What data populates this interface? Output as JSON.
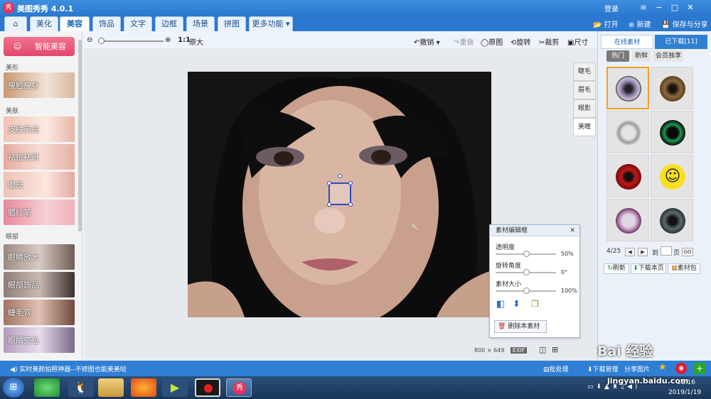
{
  "app": {
    "title": "美图秀秀 4.0.1",
    "logo_text": "秀",
    "login": "登录",
    "min": "−",
    "max": "□",
    "close": "✕"
  },
  "tabs": [
    {
      "label": "⌂"
    },
    {
      "label": "美化"
    },
    {
      "label": "美容"
    },
    {
      "label": "饰品"
    },
    {
      "label": "文字"
    },
    {
      "label": "边框"
    },
    {
      "label": "场景"
    },
    {
      "label": "拼图"
    },
    {
      "label": "更多功能 ▾"
    }
  ],
  "rightmenu": {
    "open": "打开",
    "new": "新建",
    "save": "保存与分享"
  },
  "sidebar": {
    "smart": "智能美容",
    "sections": {
      "shape": "美形",
      "skin": "美肤",
      "eye": "眼部"
    },
    "items": [
      {
        "label": "瘦脸瘦身"
      },
      {
        "label": "皮肤美白"
      },
      {
        "label": "祛痘祛斑"
      },
      {
        "label": "磨皮"
      },
      {
        "label": "腮红笔"
      },
      {
        "label": "眼睛放大"
      },
      {
        "label": "眼部饰品"
      },
      {
        "label": "睫毛膏"
      },
      {
        "label": "眼睛变色"
      }
    ]
  },
  "toolbar": {
    "ratio": "1:1",
    "original_size": "原大",
    "undo": "撤销",
    "redo": "重做",
    "original": "原图",
    "rotate": "旋转",
    "crop": "裁剪",
    "size": "尺寸"
  },
  "sidetabs": [
    {
      "label": "睫毛"
    },
    {
      "label": "眉毛"
    },
    {
      "label": "眼影"
    },
    {
      "label": "美瞳"
    }
  ],
  "editbox": {
    "title": "素材编辑框",
    "opacity_label": "透明度",
    "opacity_value": "50%",
    "opacity_level": 0.5,
    "angle_label": "旋转角度",
    "angle_value": "0°",
    "angle_level": 0.5,
    "size_label": "素材大小",
    "size_value": "100%",
    "size_level": 0.5,
    "delete": "删除本素材"
  },
  "image_info": {
    "width": "800",
    "x": "×",
    "height": "649",
    "exif": "EXIF"
  },
  "rightpanel": {
    "tab_online": "在线素材",
    "tab_downloaded": "已下载[11]",
    "subtabs": [
      {
        "label": "热门"
      },
      {
        "label": "新鲜"
      },
      {
        "label": "会员独享"
      }
    ],
    "page": "4/25",
    "goto": "到",
    "page_unit": "页",
    "go": "GO",
    "refresh": "刷新",
    "download_page": "下载本页",
    "package": "素材包"
  },
  "statusbar": {
    "tip": "实时美颜拍照神器--不修图也能美美哒",
    "batch": "批处理",
    "download_mgr": "下载管理",
    "share": "分享图片"
  },
  "clock": {
    "time": "11:16",
    "date": "2019/1/19"
  },
  "watermark": {
    "text": "Bai 经验",
    "url": "jingyan.baidu.com"
  }
}
